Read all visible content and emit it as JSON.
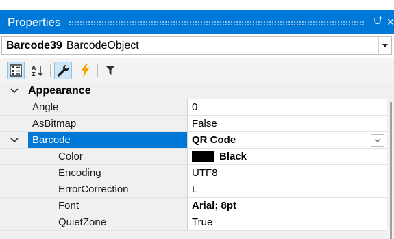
{
  "titlebar": {
    "title": "Properties",
    "pin_glyph": "⮍",
    "close_glyph": "×"
  },
  "object_selector": {
    "name": "Barcode39",
    "type": "BarcodeObject"
  },
  "toolbar": {
    "buttons": [
      {
        "name": "categorized-view",
        "icon": "categorized-icon"
      },
      {
        "name": "alphabetical-view",
        "icon": "sort-az-icon"
      },
      {
        "name": "properties-tab",
        "icon": "wrench-icon",
        "active": true
      },
      {
        "name": "events-tab",
        "icon": "lightning-icon"
      },
      {
        "name": "filter",
        "icon": "filter-icon"
      }
    ]
  },
  "grid": {
    "category": "Appearance",
    "rows": [
      {
        "label": "Angle",
        "value": "0"
      },
      {
        "label": "AsBitmap",
        "value": "False"
      },
      {
        "label": "Barcode",
        "value": "QR Code"
      },
      {
        "label": "Color",
        "value": "Black"
      },
      {
        "label": "Encoding",
        "value": "UTF8"
      },
      {
        "label": "ErrorCorrection",
        "value": "L"
      },
      {
        "label": "Font",
        "value": "Arial; 8pt"
      },
      {
        "label": "QuietZone",
        "value": "True"
      }
    ]
  },
  "colors": {
    "accent": "#0078d7",
    "grid_bg": "#f0f0f0",
    "swatch": "#000000"
  }
}
